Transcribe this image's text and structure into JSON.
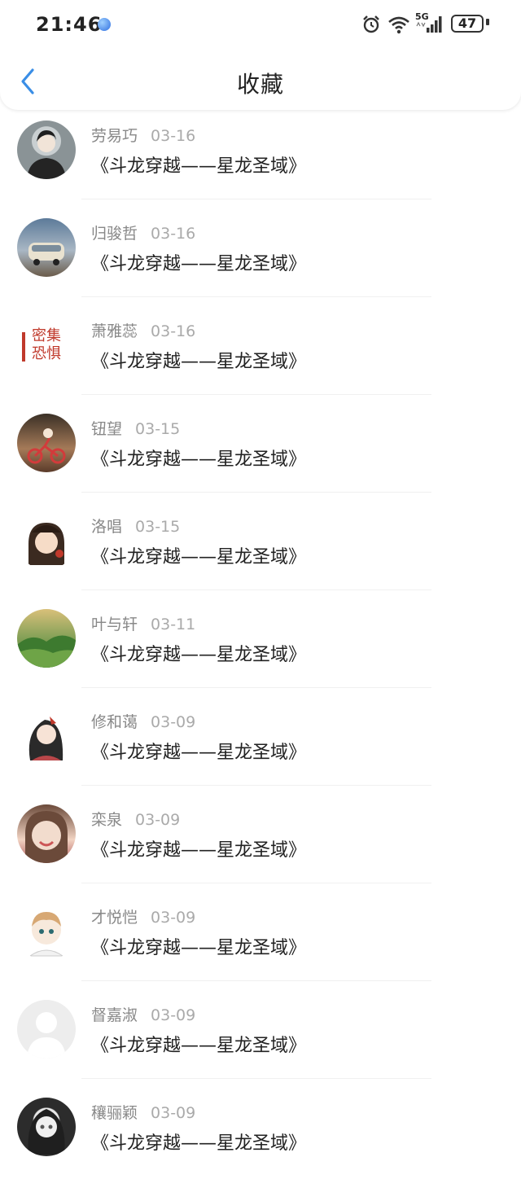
{
  "status_bar": {
    "time": "21:46",
    "network": "5G",
    "battery": "47",
    "icons": [
      "app-icon",
      "alarm-icon",
      "wifi-icon",
      "signal-icon",
      "battery-icon"
    ]
  },
  "nav": {
    "back_icon": "chevron-left-icon",
    "title": "收藏"
  },
  "colors": {
    "accent": "#3a8ee6",
    "text_primary": "#222222",
    "text_secondary": "#888888"
  },
  "favorites": [
    {
      "user": "劳易巧",
      "date": "03-16",
      "title": "《斗龙穿越——星龙圣域》"
    },
    {
      "user": "归骏哲",
      "date": "03-16",
      "title": "《斗龙穿越——星龙圣域》"
    },
    {
      "user": "萧雅蕊",
      "date": "03-16",
      "title": "《斗龙穿越——星龙圣域》"
    },
    {
      "user": "钮望",
      "date": "03-15",
      "title": "《斗龙穿越——星龙圣域》"
    },
    {
      "user": "洛唱",
      "date": "03-15",
      "title": "《斗龙穿越——星龙圣域》"
    },
    {
      "user": "叶与轩",
      "date": "03-11",
      "title": "《斗龙穿越——星龙圣域》"
    },
    {
      "user": "修和蔼",
      "date": "03-09",
      "title": "《斗龙穿越——星龙圣域》"
    },
    {
      "user": "栾泉",
      "date": "03-09",
      "title": "《斗龙穿越——星龙圣域》"
    },
    {
      "user": "才悦恺",
      "date": "03-09",
      "title": "《斗龙穿越——星龙圣域》"
    },
    {
      "user": "督嘉淑",
      "date": "03-09",
      "title": "《斗龙穿越——星龙圣域》"
    },
    {
      "user": "穰骊颖",
      "date": "03-09",
      "title": "《斗龙穿越——星龙圣域》"
    }
  ]
}
